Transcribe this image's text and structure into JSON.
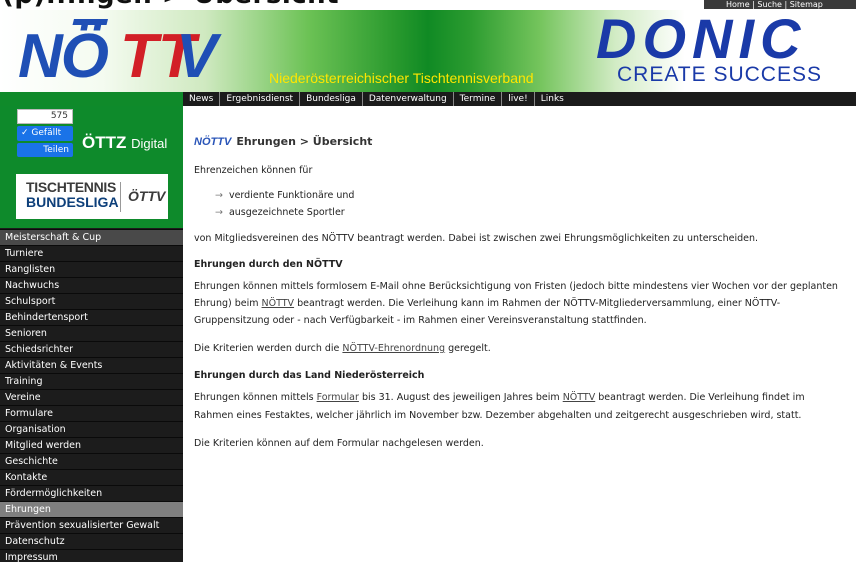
{
  "top": {
    "site_heading": "(p)...ngen > Übersicht",
    "toplinks": "Home | Suche | Sitemap"
  },
  "header": {
    "logo_text": "NÖTTV",
    "subtitle": "Niederösterreichischer Tischtennisverband",
    "sponsor": "DONIC",
    "slogan": "CREATE SUCCESS"
  },
  "nav": {
    "items": [
      "News",
      "Ergebnisdienst",
      "Bundesliga",
      "Datenverwaltung",
      "Termine",
      "live!",
      "Links"
    ]
  },
  "sidebar": {
    "fb_count": "575",
    "fb_like": "✓ Gefällt",
    "fb_share": "Teilen",
    "ottz": "ÖTTZ",
    "ottz_suffix": "Digital",
    "tt_line1": "TISCHTENNIS",
    "tt_line2": "BUNDESLIGA",
    "tt_logo": "ÖTTV",
    "menu": [
      "Meisterschaft & Cup",
      "Turniere",
      "Ranglisten",
      "Nachwuchs",
      "Schulsport",
      "Behindertensport",
      "Senioren",
      "Schiedsrichter",
      "Aktivitäten & Events",
      "Training",
      "Vereine",
      "Formulare",
      "Organisation",
      "Mitglied werden",
      "Geschichte",
      "Kontakte",
      "Fördermöglichkeiten",
      "Ehrungen",
      "Prävention sexualisierter Gewalt",
      "Datenschutz",
      "Impressum"
    ]
  },
  "main": {
    "title_logo": "NÖTTV",
    "title": "Ehrungen > Übersicht",
    "intro": "Ehrenzeichen können für",
    "bullets": [
      "verdiente Funktionäre und",
      "ausgezeichnete Sportler"
    ],
    "para1": "von Mitgliedsvereinen des NÖTTV beantragt werden. Dabei ist zwischen zwei Ehrungsmöglichkeiten zu unterscheiden.",
    "h1": "Ehrungen durch den NÖTTV",
    "p2_line1": "Ehrungen können mittels formlosem E-Mail ohne Berücksichtigung von Fristen (jedoch bitte mindestens vier Wochen vor der geplanten",
    "p2_line2_a": "Ehrung) beim ",
    "p2_link": "NÖTTV",
    "p2_line2_b": " beantragt werden. Die Verleihung kann im Rahmen der NÖTTV-Mitgliederversammlung, einer NÖTTV-",
    "p2_line3": "Gruppensitzung oder - nach Verfügbarkeit - im Rahmen einer Vereinsveranstaltung stattfinden.",
    "p3_a": "Die Kriterien werden durch die ",
    "p3_link": "NÖTTV-Ehrenordnung",
    "p3_b": " geregelt.",
    "h2": "Ehrungen durch das Land Niederösterreich",
    "p4_line1_a": "Ehrungen können mittels ",
    "p4_link1": "Formular",
    "p4_line1_b": " bis 31. August des jeweiligen Jahres beim ",
    "p4_link2": "NÖTTV",
    "p4_line1_c": " beantragt werden. Die Verleihung findet im",
    "p4_line2": "Rahmen eines Festaktes, welcher jährlich im November bzw. Dezember abgehalten und zeitgerecht ausgeschrieben wird, statt.",
    "p5": "Die Kriterien können auf dem Formular nachgelesen werden."
  },
  "colors": {
    "green": "#0e8a2b",
    "sidebar_bg": "#1c1c1c",
    "active_item": "#7f7f7f",
    "logo_blue": "#1f4fb5",
    "logo_red": "#d21f26",
    "subtitle_yellow": "#ffe600"
  }
}
